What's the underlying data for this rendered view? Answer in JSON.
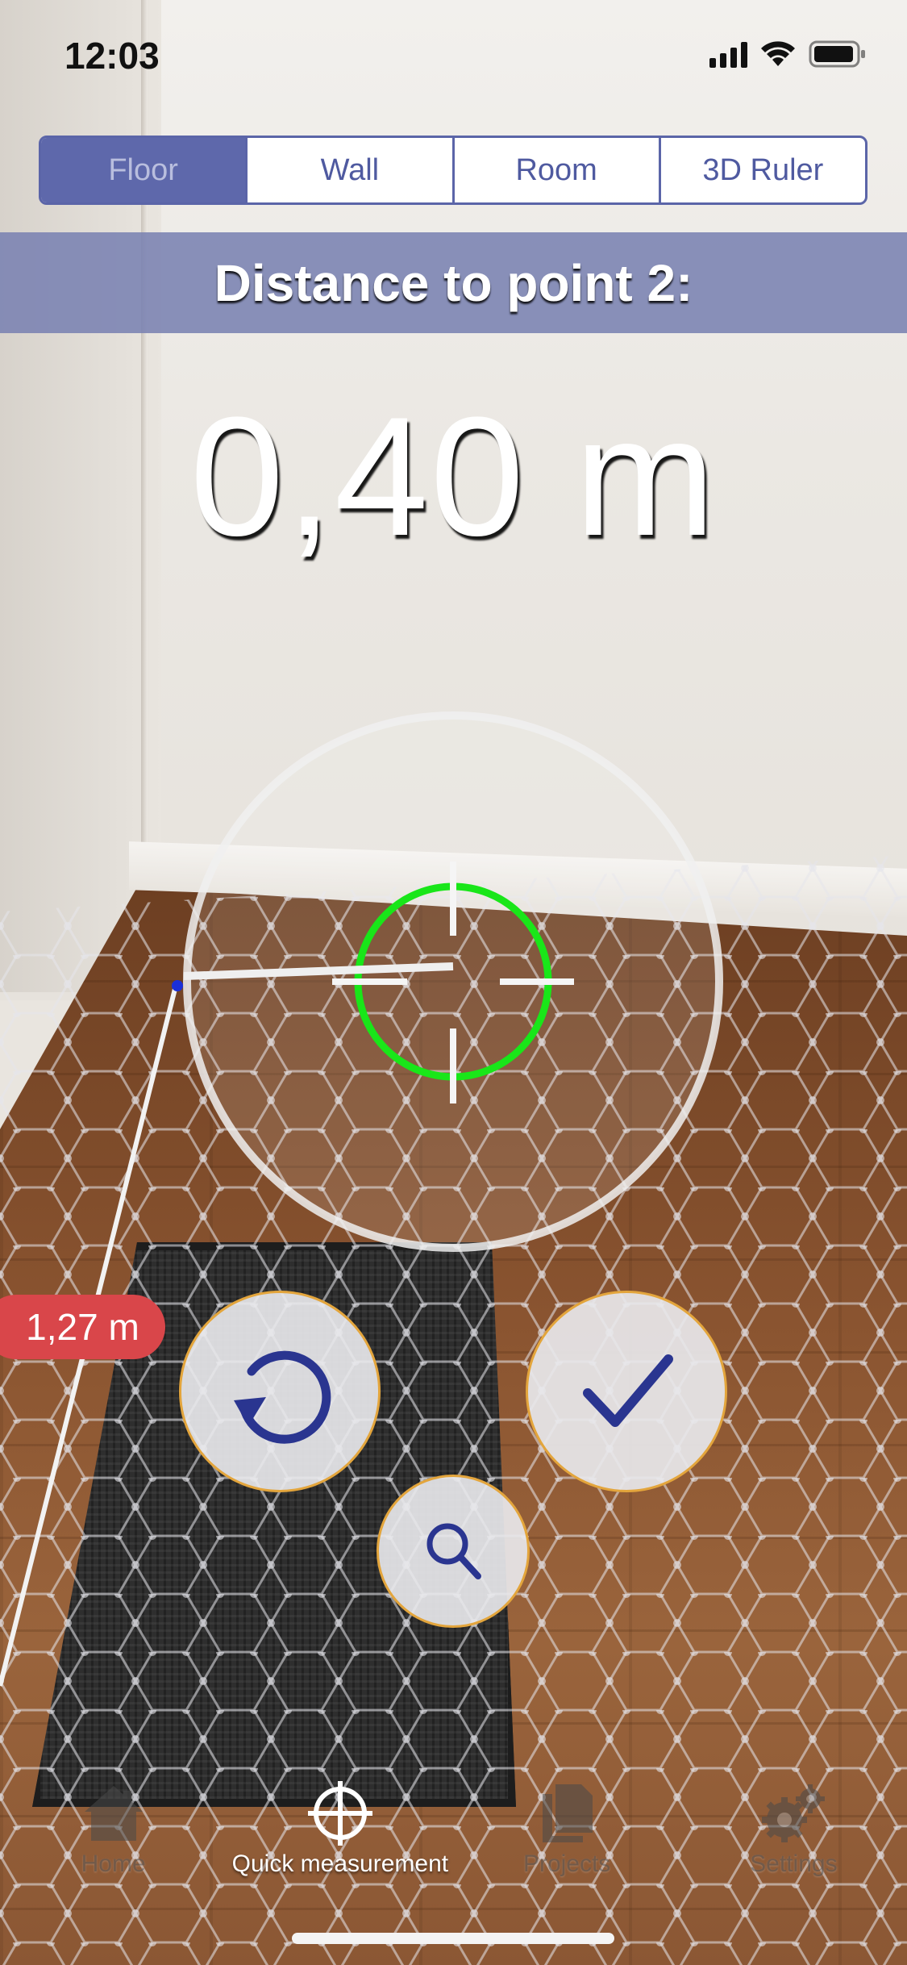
{
  "status_bar": {
    "time": "12:03"
  },
  "modes": {
    "items": [
      {
        "label": "Floor",
        "active": true
      },
      {
        "label": "Wall",
        "active": false
      },
      {
        "label": "Room",
        "active": false
      },
      {
        "label": "3D Ruler",
        "active": false
      }
    ]
  },
  "banner": {
    "text": "Distance to point 2:"
  },
  "measurement": {
    "current": "0,40 m",
    "previous_segment": "1,27 m"
  },
  "reticle": {
    "ring_color": "#19e619"
  },
  "tabbar": {
    "items": [
      {
        "label": "Home",
        "icon": "home-icon",
        "active": false
      },
      {
        "label": "Quick measurement",
        "icon": "crosshair-icon",
        "active": true
      },
      {
        "label": "Projects",
        "icon": "documents-icon",
        "active": false
      },
      {
        "label": "Settings",
        "icon": "gear-icon",
        "active": false
      }
    ]
  },
  "colors": {
    "accent": "#5e68ab",
    "banner": "#7a82b2",
    "button_border": "#e3a53c",
    "icon_blue": "#2a3590",
    "badge": "#d9464a"
  }
}
